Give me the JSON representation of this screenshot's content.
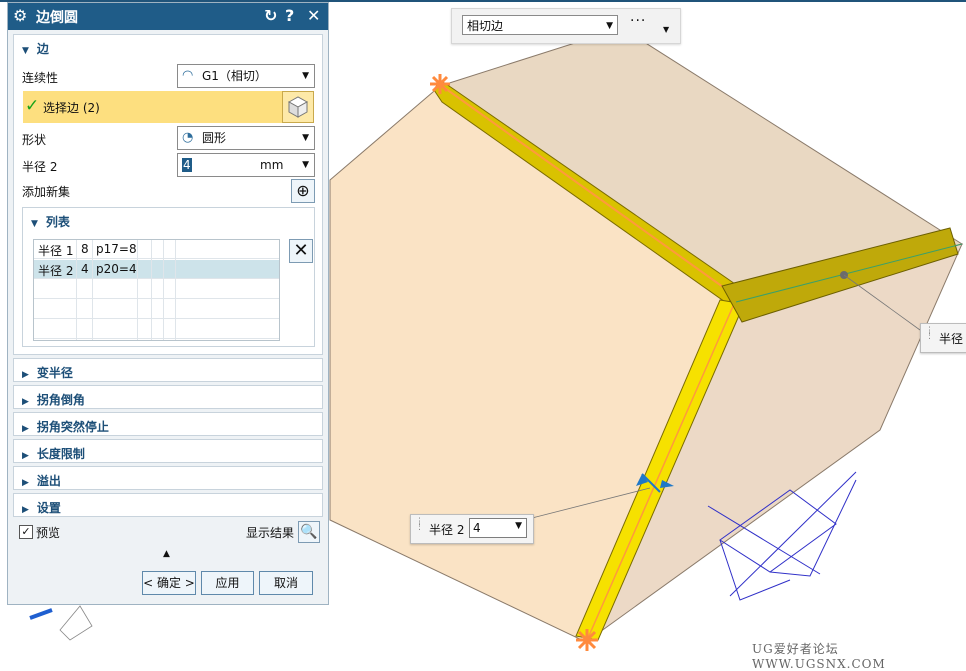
{
  "dialog": {
    "title": "边倒圆",
    "edge_group": {
      "header": "边",
      "continuity_label": "连续性",
      "continuity_value": "G1（相切）",
      "select_edge": "选择边 (2)",
      "shape_label": "形状",
      "shape_value": "圆形",
      "radius_label": "半径 2",
      "radius_value": "4",
      "radius_unit": "mm",
      "add_set_label": "添加新集"
    },
    "list_group": {
      "header": "列表",
      "rows": [
        {
          "name": "半径 1",
          "value": "8",
          "expr": "p17=8"
        },
        {
          "name": "半径 2",
          "value": "4",
          "expr": "p20=4"
        }
      ]
    },
    "collapsed_groups": [
      "变半径",
      "拐角倒角",
      "拐角突然停止",
      "长度限制",
      "溢出",
      "设置"
    ],
    "preview_label": "预览",
    "show_result_label": "显示结果",
    "ok_label": "< 确定 >",
    "apply_label": "应用",
    "cancel_label": "取消"
  },
  "selection_bar": {
    "filter_value": "相切边",
    "more_label": "···"
  },
  "viewport": {
    "radius_callout_label": "半径 2",
    "radius_callout_value": "4",
    "right_callout_label": "半径",
    "watermark": "UG爱好者论坛 WWW.UGSNX.COM"
  },
  "colors": {
    "title_bar": "#1f5c88",
    "selected_row": "#fddf7f",
    "part_face": "#fae3c5",
    "fillet_yellow": "#f5de00",
    "accent_orange": "#ff8a3d"
  }
}
